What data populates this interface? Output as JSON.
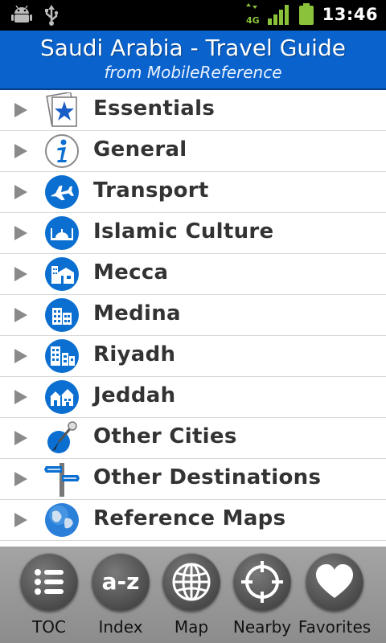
{
  "status_bar": {
    "time": "13:46",
    "network_label": "4G",
    "icons": [
      "android-debug-icon",
      "usb-icon",
      "network-4g-icon",
      "signal-icon",
      "battery-icon"
    ]
  },
  "header": {
    "title": "Saudi Arabia - Travel Guide",
    "subtitle": "from MobileReference"
  },
  "menu": {
    "items": [
      {
        "label": "Essentials",
        "icon": "star-icon"
      },
      {
        "label": "General",
        "icon": "info-icon"
      },
      {
        "label": "Transport",
        "icon": "airplane-icon"
      },
      {
        "label": "Islamic Culture",
        "icon": "mosque-icon"
      },
      {
        "label": "Mecca",
        "icon": "buildings-icon"
      },
      {
        "label": "Medina",
        "icon": "buildings-icon"
      },
      {
        "label": "Riyadh",
        "icon": "skyline-icon"
      },
      {
        "label": "Jeddah",
        "icon": "houses-icon"
      },
      {
        "label": "Other Cities",
        "icon": "pushpin-icon"
      },
      {
        "label": "Other Destinations",
        "icon": "signpost-icon"
      },
      {
        "label": "Reference Maps",
        "icon": "globe-icon"
      }
    ]
  },
  "bottom_bar": {
    "toc": "TOC",
    "index": "Index",
    "index_glyph": "a-z",
    "map": "Map",
    "nearby": "Nearby",
    "favorites": "Favorites"
  },
  "colors": {
    "header_blue": "#0a63cc",
    "icon_blue": "#0a6fd0",
    "label_text": "#333333"
  }
}
